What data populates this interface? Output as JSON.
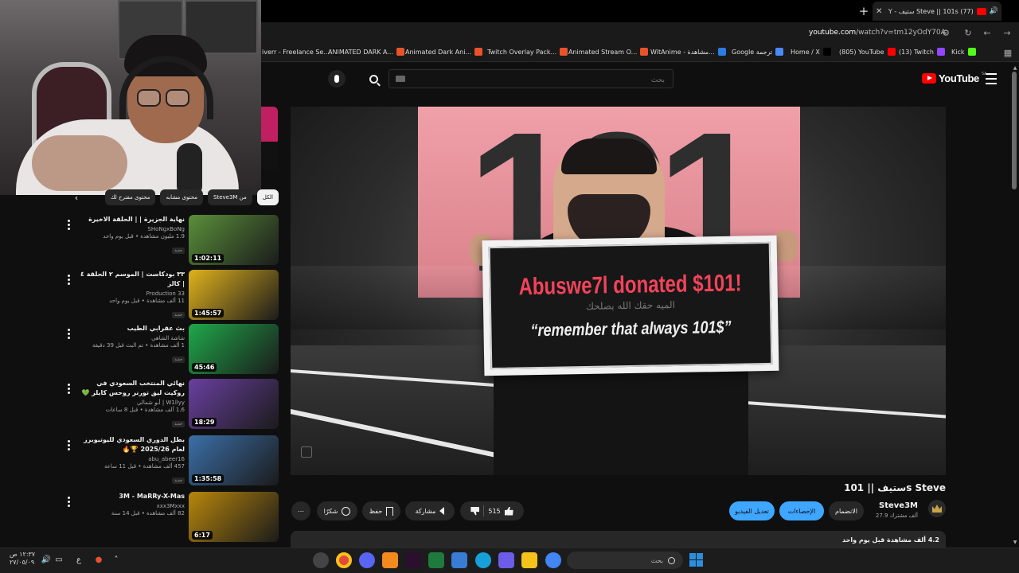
{
  "browser": {
    "tab_title": "(77) Steve || 101s ستيف - Y",
    "url_domain": "youtube.com",
    "url_path": "/watch?v=tm12yOdY70A",
    "bookmarks": [
      {
        "label": "iverr - Freelance Se...",
        "color": "#111111"
      },
      {
        "label": "ANIMATED DARK A...",
        "color": "#e8532a"
      },
      {
        "label": "Animated Dark Ani...",
        "color": "#e8532a"
      },
      {
        "label": "Twitch Overlay Pack...",
        "color": "#e8532a"
      },
      {
        "label": "Animated Stream O...",
        "color": "#e8532a"
      },
      {
        "label": "WitAnime - مشاهدة...",
        "color": "#2a7de1"
      },
      {
        "label": "Google ترجمة",
        "color": "#4a8af4"
      },
      {
        "label": "Home / X",
        "color": "#000000"
      },
      {
        "label": "(805) YouTube",
        "color": "#ff0000"
      },
      {
        "label": "(13) Twitch",
        "color": "#9146ff"
      },
      {
        "label": "Kick",
        "color": "#53fc18"
      }
    ]
  },
  "youtube": {
    "logo": "YouTube",
    "region": "SA",
    "search_placeholder": "بحث"
  },
  "video": {
    "sign_donation": "Abuswe7l donated $101!",
    "sign_arabic": "الميه حقك الله يصلحك",
    "sign_quote": "“remember that always 101$”",
    "bg_number": "101",
    "title": "ستيف || 101s Steve",
    "channel": "Steve3M",
    "subscribers": "27.9 ألف مشترك",
    "join_label": "الانضمام",
    "stats_label": "الإحصاءات",
    "edit_label": "تعديل الفيديو",
    "likes": "515",
    "share_label": "مشاركة",
    "save_label": "حفظ",
    "thanks_label": "شكرًا",
    "description_views": "4.2 ألف مشاهدة قبل يوم واحد"
  },
  "sidebar": {
    "chips": [
      "الكل",
      "من Steve3M",
      "محتوى مشابه",
      "محتوى مقترح لك"
    ],
    "recommendations": [
      {
        "title": "نهاية الجزيرة | | الحلقة الاخيرة",
        "channel": "SHoNgxBoNg",
        "views": "1.9 مليون مشاهدة • قبل يوم واحد",
        "badge": "جديد",
        "duration": "1:02:11",
        "thumb_color": "#5a8f3a"
      },
      {
        "title": "٣٣ بودكاست | الموسم ٢ الحلقة ٤ | كالز",
        "channel": "33 Production",
        "views": "11 ألف مشاهدة • قبل يوم واحد",
        "badge": "جديد",
        "duration": "1:45:57",
        "thumb_color": "#e0b21c"
      },
      {
        "title": "بث عقرابي الطيب",
        "channel": "شاشة الشاهي",
        "views": "1 ألف مشاهدة • تم البث قبل 39 دقيقة",
        "badge": "جديد",
        "duration": "45:46",
        "thumb_color": "#1fa84a"
      },
      {
        "title": "نهائي المنتخب السعودي في روكيت ليق تورنر روحس كايلز 💚🏆",
        "channel": "W1llyy | أبو شمالي",
        "views": "1.6 ألف مشاهدة • قبل 8 ساعات",
        "badge": "جديد",
        "duration": "18:29",
        "thumb_color": "#6a3fa0"
      },
      {
        "title": "بطل الدوري السعودي لليوتيوبرز لعام 2025/26 🏆🔥",
        "channel": "abu_abeer16",
        "views": "457 ألف مشاهدة • قبل 11 ساعة",
        "badge": "جديد",
        "duration": "1:35:58",
        "thumb_color": "#3b6fa8"
      },
      {
        "title": "3M - MaRRy-X-Mas",
        "channel": "xxx3Mxxx",
        "views": "82 ألف مشاهدة • قبل 14 سنة",
        "badge": "",
        "duration": "6:17",
        "thumb_color": "#b8860b"
      }
    ]
  },
  "taskbar": {
    "time": "١٢:٣٧ ص",
    "date": "٢٧/٠٥/٠٩",
    "search_label": "بحث",
    "lang": "ع"
  }
}
